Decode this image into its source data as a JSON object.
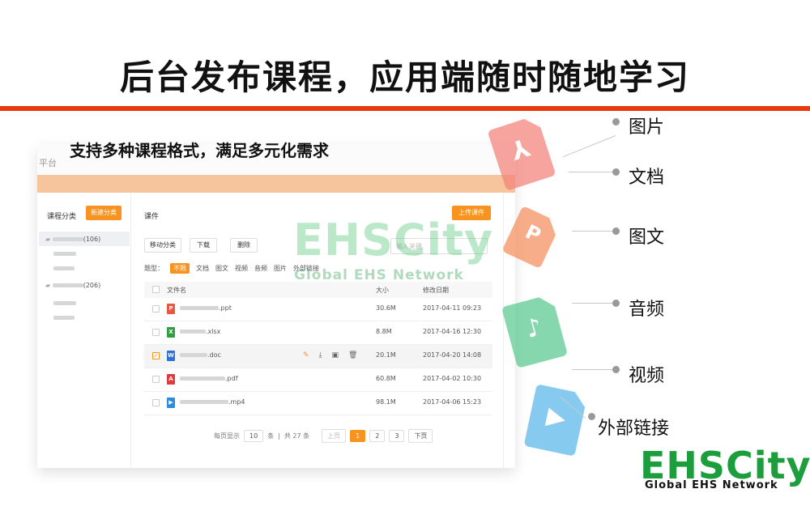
{
  "slide": {
    "title": "后台发布课程，应用端随时随地学习",
    "subtitle": "支持多种课程格式，满足多元化需求"
  },
  "app": {
    "platform_label": "平台",
    "sidebar": {
      "header": "课程分类",
      "new_category_button": "新建分类",
      "items": [
        {
          "label": "(106)",
          "selected": true
        },
        {
          "label": "",
          "selected": false
        },
        {
          "label": "",
          "selected": false
        },
        {
          "label": "(206)",
          "selected": false
        },
        {
          "label": "",
          "selected": false
        },
        {
          "label": "",
          "selected": false
        }
      ]
    },
    "main": {
      "title": "课件",
      "upload_button": "上传课件",
      "toolbar": {
        "move": "移动分类",
        "download": "下载",
        "delete": "删除"
      },
      "search_placeholder": "输入关键",
      "types_label": "题型：",
      "types": [
        "不限",
        "文档",
        "图文",
        "视频",
        "音频",
        "图片",
        "外部链接"
      ],
      "columns": {
        "name": "文件名",
        "size": "大小",
        "date": "修改日期"
      },
      "files": [
        {
          "ext": ".ppt",
          "icon": "ppt-icon",
          "color": "#e9573f",
          "glyph": "P",
          "size": "30.6M",
          "date": "2017-04-11 09:23",
          "checked": false
        },
        {
          "ext": ".xlsx",
          "icon": "xlsx-icon",
          "color": "#2f9e44",
          "glyph": "X",
          "size": "8.8M",
          "date": "2017-04-16 12:30",
          "checked": false
        },
        {
          "ext": ".doc",
          "icon": "doc-icon",
          "color": "#2f6fd6",
          "glyph": "W",
          "size": "20.1M",
          "date": "2017-04-20 14:08",
          "checked": true
        },
        {
          "ext": ".pdf",
          "icon": "pdf-icon",
          "color": "#e0393e",
          "glyph": "A",
          "size": "60.8M",
          "date": "2017-04-02 10:30",
          "checked": false
        },
        {
          "ext": ".mp4",
          "icon": "mp4-icon",
          "color": "#2b8de0",
          "glyph": "▶",
          "size": "98.1M",
          "date": "2017-04-06 15:23",
          "checked": false
        }
      ],
      "pager": {
        "per_page_prefix": "每页显示",
        "per_page": "10",
        "per_page_suffix": "条",
        "total": "共 27 条",
        "prev": "上页",
        "pages": [
          "1",
          "2",
          "3"
        ],
        "next": "下页"
      }
    }
  },
  "watermark": {
    "main": "EHSCity",
    "sub": "Global EHS Network"
  },
  "file_types": [
    "图片",
    "文档",
    "图文",
    "音频",
    "视频",
    "外部链接"
  ],
  "logo": {
    "main": "EHSCity",
    "sub": "Global EHS Network"
  },
  "colors": {
    "accent": "#f7931e",
    "rule": "#e8380d",
    "logo_green": "#1c9e3c"
  }
}
